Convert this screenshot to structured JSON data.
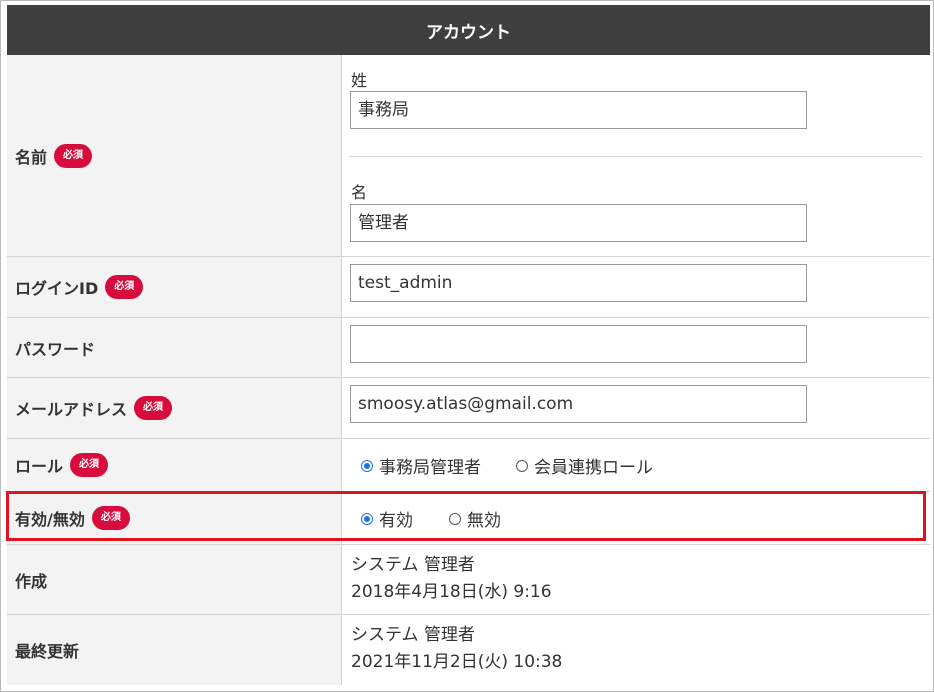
{
  "header": {
    "title": "アカウント"
  },
  "required_badge": "必須",
  "name": {
    "label": "名前",
    "last": {
      "label": "姓",
      "value": "事務局"
    },
    "first": {
      "label": "名",
      "value": "管理者"
    }
  },
  "login_id": {
    "label": "ログインID",
    "value": "test_admin"
  },
  "password": {
    "label": "パスワード",
    "value": ""
  },
  "email": {
    "label": "メールアドレス",
    "value": "smoosy.atlas@gmail.com"
  },
  "role": {
    "label": "ロール",
    "options": [
      "事務局管理者",
      "会員連携ロール"
    ],
    "selected": "事務局管理者"
  },
  "status": {
    "label": "有効/無効",
    "options": [
      "有効",
      "無効"
    ],
    "selected": "有効"
  },
  "created": {
    "label": "作成",
    "user": "システム 管理者",
    "datetime": "2018年4月18日(水) 9:16"
  },
  "updated": {
    "label": "最終更新",
    "user": "システム 管理者",
    "datetime": "2021年11月2日(火) 10:38"
  },
  "colors": {
    "header_bg": "#3f3f3f",
    "badge": "#d70c3c",
    "highlight": "#e0141e",
    "radio_selected": "#1a73e8"
  }
}
